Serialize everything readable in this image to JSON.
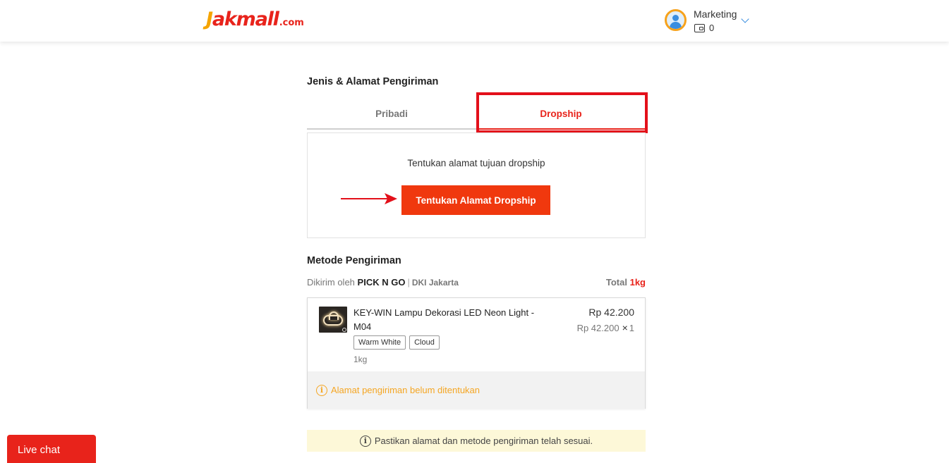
{
  "header": {
    "logo_main": "akmall",
    "logo_j": "J",
    "logo_suffix": ".com",
    "user_name": "Marketing",
    "wallet_balance": "0"
  },
  "shipping_address": {
    "title": "Jenis & Alamat Pengiriman",
    "tabs": [
      {
        "label": "Pribadi",
        "active": false
      },
      {
        "label": "Dropship",
        "active": true
      }
    ],
    "prompt": "Tentukan alamat tujuan dropship",
    "button_label": "Tentukan Alamat Dropship"
  },
  "shipping_method": {
    "title": "Metode Pengiriman",
    "sent_by_label": "Dikirim oleh",
    "courier": "PICK N GO",
    "separator": "|",
    "location": "DKI Jakarta",
    "total_label": "Total",
    "total_weight": "1kg"
  },
  "product": {
    "name": "KEY-WIN Lampu Dekorasi LED Neon Light - M04",
    "variants": [
      "Warm White",
      "Cloud"
    ],
    "weight": "1kg",
    "price": "Rp 42.200",
    "unit_price": "Rp 42.200",
    "times": "×",
    "quantity": "1",
    "warning": "Alamat pengiriman belum ditentukan"
  },
  "notice": {
    "text": "Pastikan alamat dan metode pengiriman telah sesuai."
  },
  "livechat": {
    "label": "Live chat"
  },
  "colors": {
    "brand_red": "#e8231b",
    "button_orange": "#f0380e",
    "warning": "#f5a623",
    "notice_bg": "#fdf8d8",
    "annotation_red": "#e3101a"
  }
}
